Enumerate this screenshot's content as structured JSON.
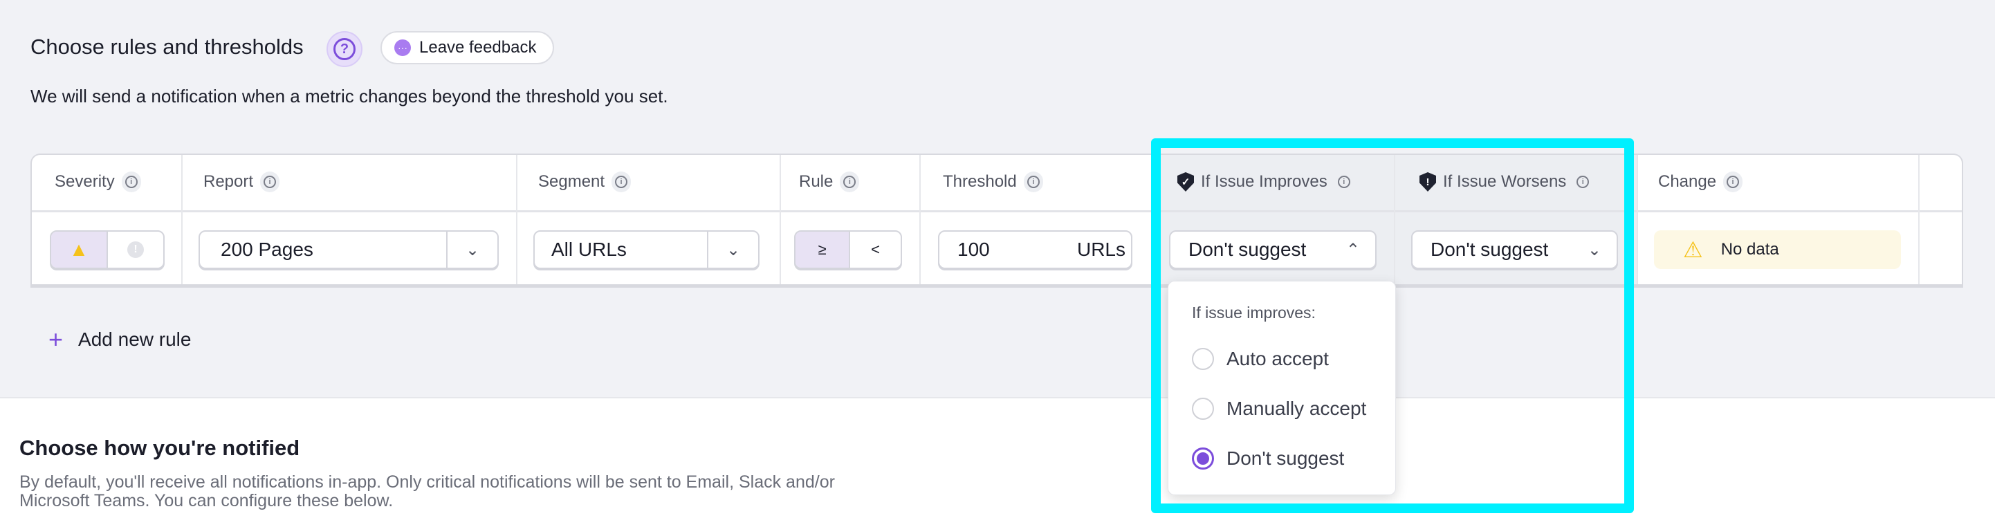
{
  "header": {
    "title": "Choose rules and thresholds",
    "feedback_label": "Leave feedback",
    "subtitle": "We will send a notification when a metric changes beyond the threshold you set."
  },
  "table": {
    "columns": [
      "Severity",
      "Report",
      "Segment",
      "Rule",
      "Threshold",
      "If Issue Improves",
      "If Issue Worsens",
      "Change"
    ],
    "row": {
      "report": "200 Pages",
      "segment": "All URLs",
      "rule_options": [
        "≥",
        "<"
      ],
      "threshold_value": "100",
      "threshold_unit": "URLs",
      "improves": "Don't suggest",
      "worsens": "Don't suggest",
      "change": "No data"
    }
  },
  "add_rule_label": "Add new rule",
  "dropdown": {
    "heading": "If issue improves:",
    "options": [
      "Auto accept",
      "Manually accept",
      "Don't suggest"
    ],
    "selected": "Don't suggest"
  },
  "notify": {
    "title": "Choose how you're notified",
    "text": "By default, you'll receive all notifications in-app. Only critical notifications will be sent to Email, Slack and/or Microsoft Teams. You can configure these below."
  },
  "colors": {
    "accent": "#7c4ddb",
    "highlight": "#00f0ff",
    "warning": "#f5c21b"
  }
}
